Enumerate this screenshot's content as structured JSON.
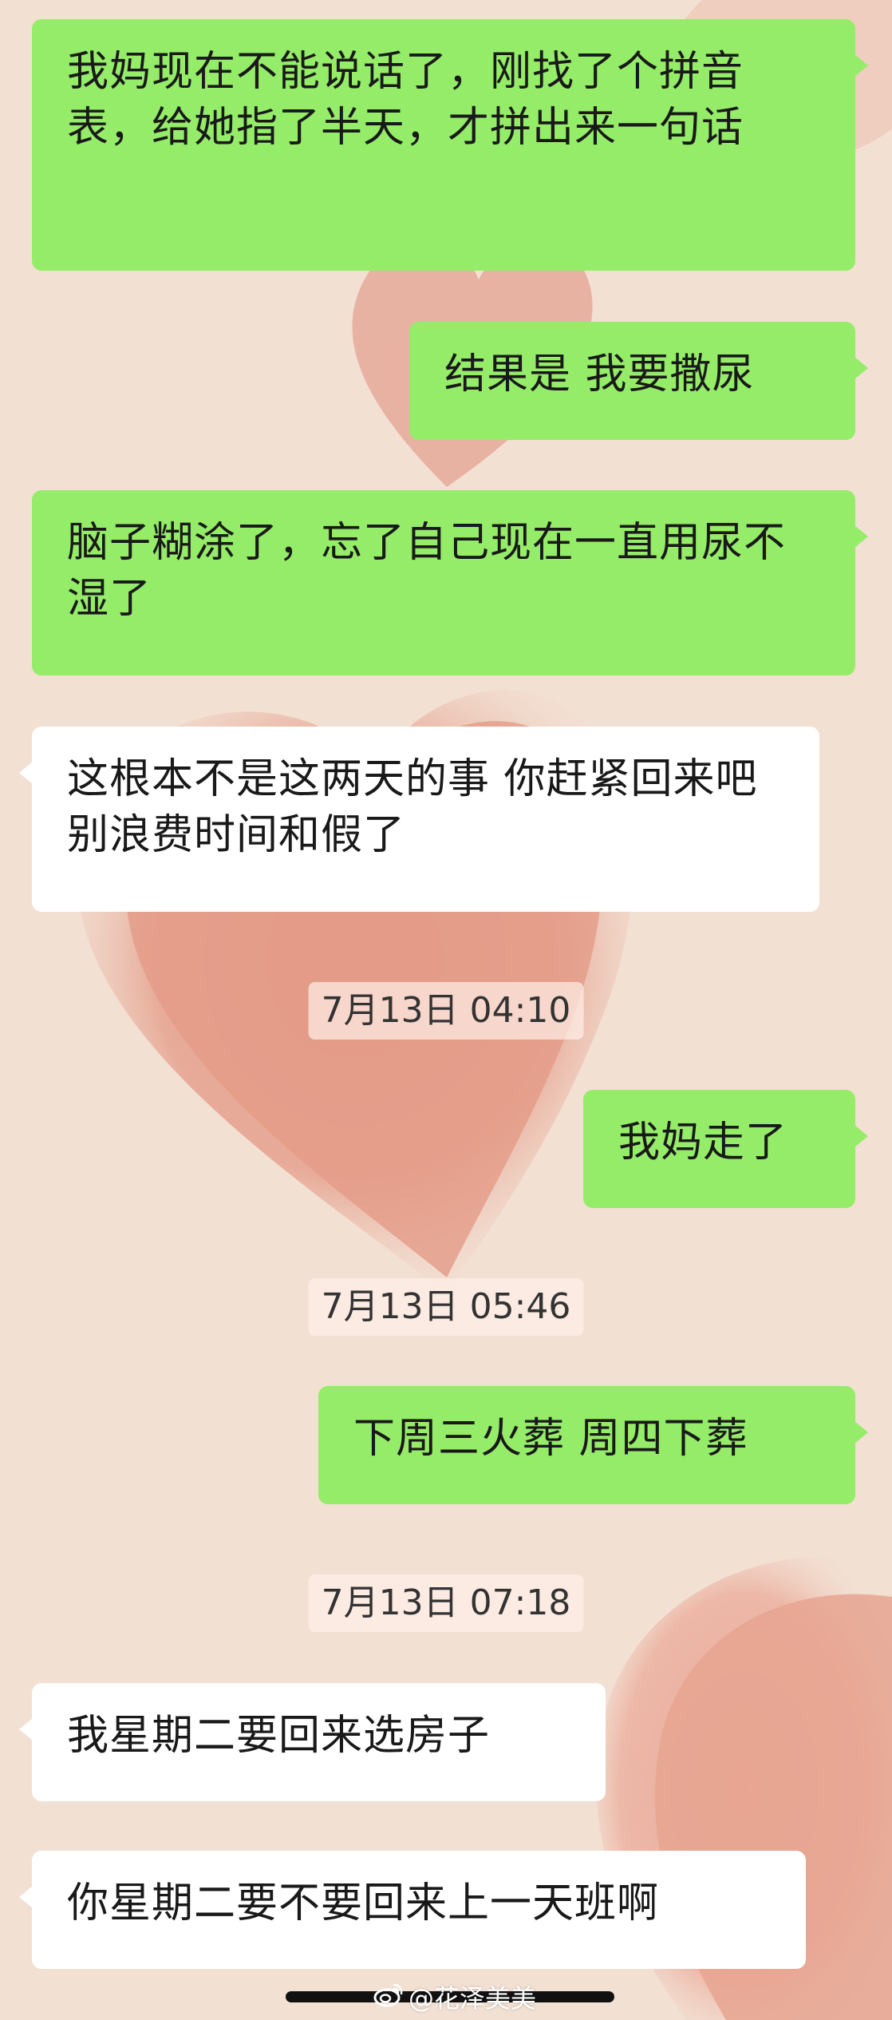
{
  "messages": [
    {
      "side": "sent",
      "text": "我妈现在不能说话了，刚找了个拼音表，给她指了半天，才拼出来一句话"
    },
    {
      "side": "sent",
      "text": "结果是 我要撒尿"
    },
    {
      "side": "sent",
      "text": "脑子糊涂了，忘了自己现在一直用尿不湿了"
    },
    {
      "side": "received",
      "text": "这根本不是这两天的事 你赶紧回来吧 别浪费时间和假了"
    },
    {
      "type": "timestamp",
      "text": "7月13日 04:10"
    },
    {
      "side": "sent",
      "text": "我妈走了"
    },
    {
      "type": "timestamp",
      "text": "7月13日 05:46"
    },
    {
      "side": "sent",
      "text": "下周三火葬 周四下葬"
    },
    {
      "type": "timestamp",
      "text": "7月13日 07:18"
    },
    {
      "side": "received",
      "text": "我星期二要回来选房子"
    },
    {
      "side": "received",
      "text": "你星期二要不要回来上一天班啊"
    }
  ],
  "watermark": {
    "text": "@花泽美美",
    "icon": "weibo-icon"
  },
  "colors": {
    "sent_bubble": "#95ec69",
    "received_bubble": "#ffffff",
    "background": "#f2e0d3",
    "heart": "#e3a08e"
  }
}
